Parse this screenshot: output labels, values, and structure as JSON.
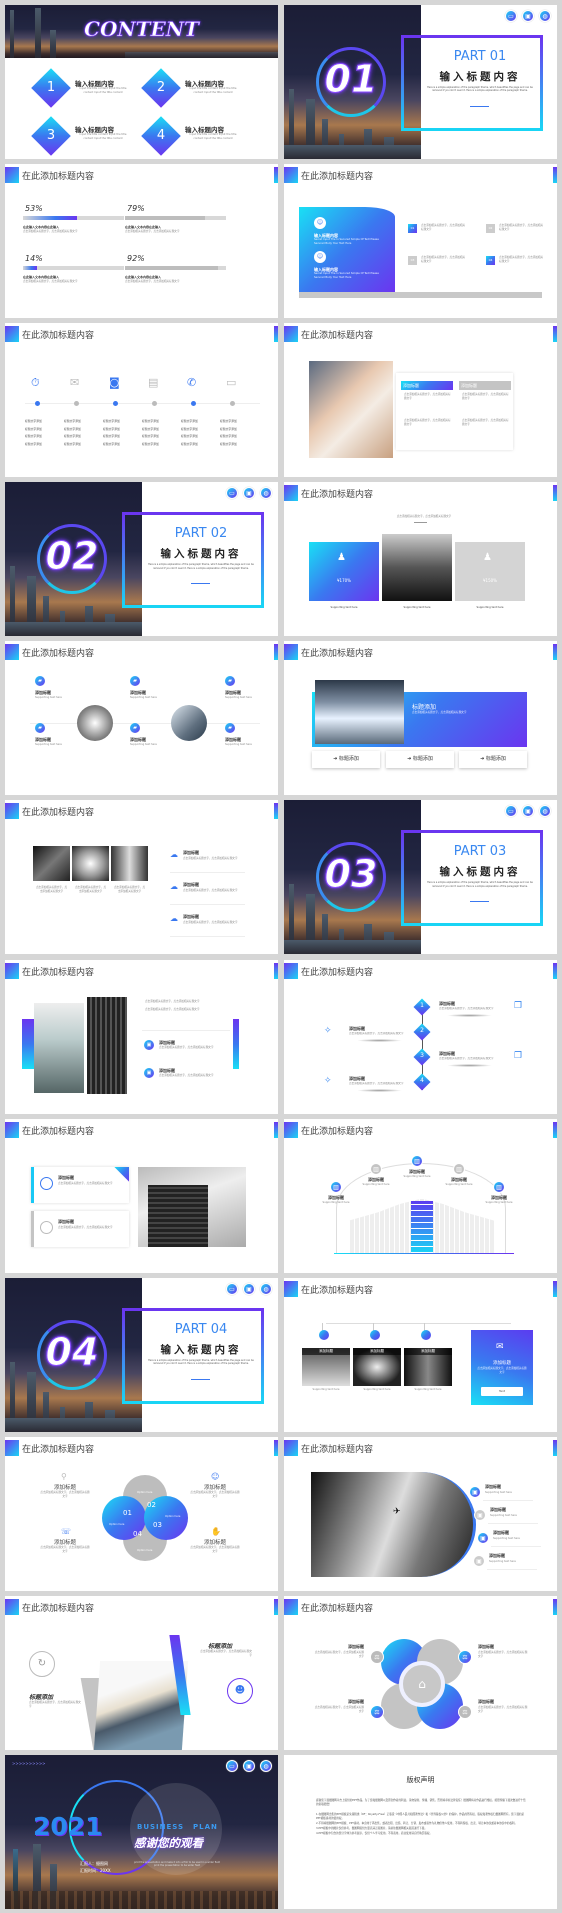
{
  "colors": {
    "accent_blue": "#3a78f0",
    "accent_purple": "#6b35f0",
    "accent_cyan": "#19e0f5",
    "gray": "#c8c8c8"
  },
  "header_title": "在此添加标题内容",
  "filler": "点击添加相关标题文字，点击添加相关标题文字",
  "supporting": "Supporting text here",
  "add_title": "添加标题",
  "title_add": "标题添加",
  "contents": {
    "title": "CONTENT",
    "items": [
      {
        "num": "1",
        "title": "输入标题内容",
        "desc": "Input the title content Input the title content Input the title content"
      },
      {
        "num": "2",
        "title": "输入标题内容",
        "desc": "Input the title content Input the title content Input the title content"
      },
      {
        "num": "3",
        "title": "输入标题内容",
        "desc": "Input the title content Input the title content Input the title content"
      },
      {
        "num": "4",
        "title": "输入标题内容",
        "desc": "Input the title content Input the title content Input the title content"
      }
    ]
  },
  "parts": [
    {
      "label": "PART 01",
      "number": "01",
      "title": "输入标题内容"
    },
    {
      "label": "PART 02",
      "number": "02",
      "title": "输入标题内容"
    },
    {
      "label": "PART 03",
      "number": "03",
      "title": "输入标题内容"
    },
    {
      "label": "PART 04",
      "number": "04",
      "title": "输入标题内容"
    }
  ],
  "part_desc": "Here is a simple explanation of the paragraph theme, which beautifies the page and can be removed if you don't need it. Here is a simple explanation of the paragraph theme.",
  "part_icons": [
    "laptop-icon",
    "briefcase-icon",
    "globe-icon"
  ],
  "progress": [
    {
      "pct": "53%",
      "value": 53,
      "label": "在此输入文本内容在此输入"
    },
    {
      "pct": "79%",
      "value": 79,
      "label": "在此输入文本内容在此输入"
    },
    {
      "pct": "14%",
      "value": 14,
      "label": "在此输入文本内容在此输入"
    },
    {
      "pct": "92%",
      "value": 92,
      "label": "在此输入文本内容在此输入"
    }
  ],
  "wave": {
    "items": [
      {
        "title": "输入标题内容",
        "desc": "Secret Input The In Secured Simple Of Text Please Secured Body Your Text Here"
      },
      {
        "title": "输入标题内容",
        "desc": "Secret Input The In Secured Simple Of Text Please Secured Body Your Text Here"
      }
    ],
    "nums": [
      "01",
      "02",
      "03",
      "04"
    ]
  },
  "icon_row": {
    "icons": [
      "clock-dollar-icon",
      "mail-icon",
      "camera-icon",
      "document-icon",
      "phone-icon",
      "monitor-icon"
    ],
    "bullet": "标题文字添加"
  },
  "price_cards": [
    {
      "value": "¥170%"
    },
    {
      "value": "¥150%"
    }
  ],
  "steps": [
    "1",
    "2",
    "3",
    "4"
  ],
  "petals": [
    {
      "num": "01",
      "opt": "Option here"
    },
    {
      "num": "02",
      "opt": "Option here"
    },
    {
      "num": "03",
      "opt": "Option here"
    },
    {
      "num": "04",
      "opt": "Option here"
    }
  ],
  "card_button": "Text",
  "ending": {
    "year": "2021",
    "business": "BUSINESS",
    "plan": "PLAN",
    "thanks": "感谢您的观看",
    "reporter": "汇报人：摄图网",
    "time": "汇报时间：20XX",
    "desc": "print the presentation and make it into a film to be used in a wider field print the presentation to be wider field",
    "arrows": ">>>>>>>>>>"
  },
  "copyright": {
    "title": "版权声明",
    "paragraphs": [
      "感谢您下载摄图网平台上提供的PPT作品，为了您和摄图网以及原创作者的利益，请勿复制、传播、销售，否则将承担法律责任！摄图网将对作品进行维权，按照传播下载次数进行十倍的索取赔偿！",
      "1.在摄图网出售的PPT模板是免版税类（RF：Royalty-Free）正版受《中国人民共和国著作法》和《世界版权公约》的保护，作品的所有权、版权和著作权归摄图网所有，您下载的是PPT模板素材的使用权。",
      "2.不得将摄图网的PPT模板、PPT素材，本身用于再出售，或者出租、出借、转让、分销、发布或者作为礼物供他人使用，不得转授权、出卖、转让本协议或者本协议中的权利。",
      "3.PPT模板中的图片仅供参考，摄图网提供大量高清正版图片，请前往摄图网相关频道进行下载。",
      "4.PPT模板中包含的部分字体为参考展示，仅供个人学习使用，不得商用，商业使用请自行购买版权。"
    ]
  }
}
